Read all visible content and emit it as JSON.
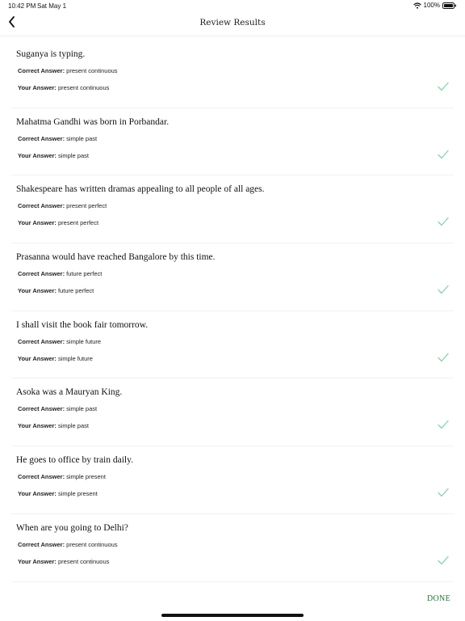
{
  "status_bar": {
    "time": "10:42 PM",
    "date": "Sat May 1",
    "battery": "100%"
  },
  "nav": {
    "title": "Review Results",
    "back_icon": "chevron-left-icon"
  },
  "labels": {
    "correct": "Correct Answer:",
    "yours": "Your Answer:"
  },
  "results": [
    {
      "question": "Suganya is typing.",
      "correct": "present continuous",
      "yours": "present continuous",
      "is_correct": true
    },
    {
      "question": "Mahatma Gandhi was born in Porbandar.",
      "correct": "simple past",
      "yours": "simple past",
      "is_correct": true
    },
    {
      "question": "Shakespeare has written dramas appealing to all people of all ages.",
      "correct": "present perfect",
      "yours": "present perfect",
      "is_correct": true
    },
    {
      "question": "Prasanna would have reached Bangalore by this time.",
      "correct": "future perfect",
      "yours": "future perfect",
      "is_correct": true
    },
    {
      "question": "I shall visit the book fair tomorrow.",
      "correct": "simple future",
      "yours": "simple future",
      "is_correct": true
    },
    {
      "question": "Asoka was a Mauryan King.",
      "correct": "simple past",
      "yours": "simple past",
      "is_correct": true
    },
    {
      "question": "He goes to office by train daily.",
      "correct": "simple present",
      "yours": "simple present",
      "is_correct": true
    },
    {
      "question": "When are you going to Delhi?",
      "correct": "present continuous",
      "yours": "present continuous",
      "is_correct": true
    }
  ],
  "done_label": "DONE",
  "colors": {
    "check": "#7fd6a4",
    "done": "#1c7a2a"
  }
}
